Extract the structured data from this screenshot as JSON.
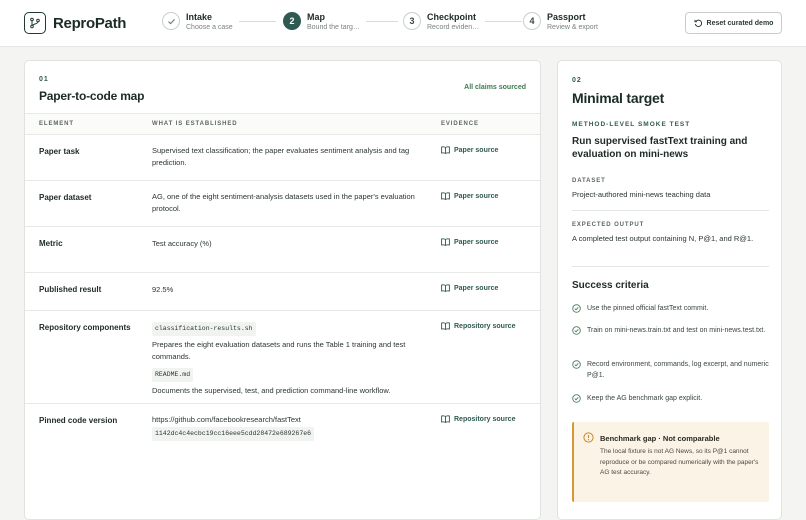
{
  "app": {
    "name": "ReproPath"
  },
  "stepper": [
    {
      "num": "",
      "title": "Intake",
      "subtitle": "Choose a case",
      "state": "done"
    },
    {
      "num": "2",
      "title": "Map",
      "subtitle": "Bound the targ…",
      "state": "active"
    },
    {
      "num": "3",
      "title": "Checkpoint",
      "subtitle": "Record eviden…",
      "state": "todo"
    },
    {
      "num": "4",
      "title": "Passport",
      "subtitle": "Review & export",
      "state": "todo"
    }
  ],
  "header": {
    "reset_label": "Reset curated demo"
  },
  "map": {
    "eyebrow": "01",
    "title": "Paper-to-code map",
    "status": "All claims sourced",
    "columns": {
      "element": "ELEMENT",
      "what": "WHAT IS ESTABLISHED",
      "evidence": "EVIDENCE"
    },
    "rows": [
      {
        "element": "Paper task",
        "what": "Supervised text classification; the paper evaluates sentiment analysis and tag prediction.",
        "evidence": "Paper source"
      },
      {
        "element": "Paper dataset",
        "what": "AG, one of the eight sentiment-analysis datasets used in the paper's evaluation protocol.",
        "evidence": "Paper source"
      },
      {
        "element": "Metric",
        "what": "Test accuracy (%)",
        "evidence": "Paper source"
      },
      {
        "element": "Published result",
        "what": "92.5%",
        "evidence": "Paper source"
      },
      {
        "element": "Repository components",
        "code1": "classification-results.sh",
        "desc1": "Prepares the eight evaluation datasets and runs the Table 1 training and test commands.",
        "code2": "README.md",
        "desc2": "Documents the supervised, test, and prediction command-line workflow.",
        "evidence": "Repository source"
      },
      {
        "element": "Pinned code version",
        "url": "https://github.com/facebookresearch/fastText",
        "commit": "1142dc4c4ecbc19cc16eee5cdd28472e689267e6",
        "evidence": "Repository source"
      }
    ]
  },
  "target": {
    "eyebrow": "02",
    "title": "Minimal target",
    "method_label": "METHOD-LEVEL SMOKE TEST",
    "method_title": "Run supervised fastText training and evaluation on mini-news",
    "dataset_label": "DATASET",
    "dataset_value": "Project-authored mini-news teaching data",
    "output_label": "EXPECTED OUTPUT",
    "output_value": "A completed test output containing N, P@1, and R@1.",
    "criteria_title": "Success criteria",
    "criteria": [
      "Use the pinned official fastText commit.",
      "Train on mini-news.train.txt and test on mini-news.test.txt.",
      "Record environment, commands, log excerpt, and numeric P@1.",
      "Keep the AG benchmark gap explicit."
    ],
    "warning_title": "Benchmark gap · Not comparable",
    "warning_text": "The local fixture is not AG News, so its P@1 cannot reproduce or be compared numerically with the paper's AG test accuracy."
  },
  "colors": {
    "accent": "#2f5a52",
    "success": "#3d7a4e",
    "warning": "#d79a33"
  }
}
